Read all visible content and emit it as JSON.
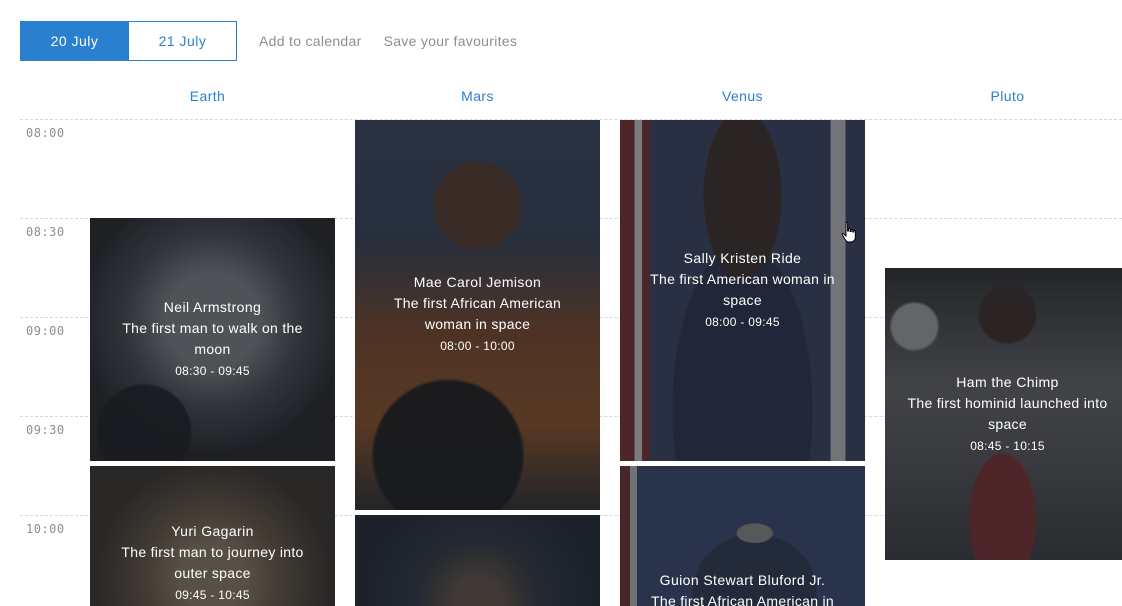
{
  "toolbar": {
    "tabs": [
      {
        "label": "20 July",
        "active": true
      },
      {
        "label": "21 July",
        "active": false
      }
    ],
    "add_to_calendar": "Add to calendar",
    "save_favourites": "Save your favourites"
  },
  "columns": [
    "Earth",
    "Mars",
    "Venus",
    "Pluto"
  ],
  "times": [
    "08:00",
    "08:30",
    "09:00",
    "09:30",
    "10:00"
  ],
  "events": [
    {
      "name": "Neil Armstrong",
      "description": "The first man to walk on the moon",
      "time": "08:30 - 09:45"
    },
    {
      "name": "Yuri Gagarin",
      "description": "The first man to journey into outer space",
      "time": "09:45 - 10:45"
    },
    {
      "name": "Mae Carol Jemison",
      "description": "The first African American woman in space",
      "time": "08:00 - 10:00"
    },
    {
      "name": "",
      "description": "",
      "time": ""
    },
    {
      "name": "Sally Kristen Ride",
      "description": "The first American woman in space",
      "time": "08:00 - 09:45"
    },
    {
      "name": "Guion Stewart Bluford Jr.",
      "description": "The first African American in",
      "time": ""
    },
    {
      "name": "Ham the Chimp",
      "description": "The first hominid launched into space",
      "time": "08:45 - 10:15"
    }
  ],
  "colors": {
    "accent": "#2a7fce",
    "muted_text": "#8a8f96",
    "grid": "#d6d8db"
  },
  "icons": [
    "hand-pointer-cursor"
  ]
}
